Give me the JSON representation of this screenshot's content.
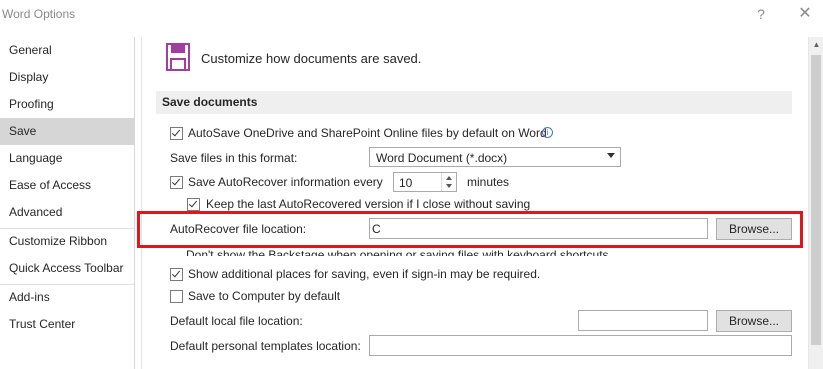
{
  "window": {
    "title": "Word Options",
    "help_glyph": "?",
    "close_glyph": "✕"
  },
  "nav": {
    "items": [
      "General",
      "Display",
      "Proofing",
      "Save",
      "Language",
      "Ease of Access",
      "Advanced",
      "Customize Ribbon",
      "Quick Access Toolbar",
      "Add-ins",
      "Trust Center"
    ],
    "selected": "Save"
  },
  "header": {
    "text": "Customize how documents are saved.",
    "icon": "save-floppy-icon",
    "icon_color": "#a13ea1"
  },
  "section": {
    "title": "Save documents"
  },
  "options": {
    "autosave_label": "AutoSave OneDrive and SharePoint Online files by default on Word",
    "autosave_checked": true,
    "save_format_label": "Save files in this format:",
    "save_format_value": "Word Document (*.docx)",
    "autorecover_label": "Save AutoRecover information every",
    "autorecover_checked": true,
    "autorecover_minutes": "10",
    "minutes_label": "minutes",
    "keep_last_label": "Keep the last AutoRecovered version if I close without saving",
    "keep_last_checked": true,
    "autorecover_location_label": "AutoRecover file location:",
    "autorecover_location_value": "C",
    "browse_label": "Browse...",
    "backstage_label": "Don't show the Backstage when opening or saving files with keyboard shortcuts",
    "additional_places_label": "Show additional places for saving, even if sign-in may be required.",
    "additional_places_checked": true,
    "save_computer_label": "Save to Computer by default",
    "save_computer_checked": false,
    "default_local_label": "Default local file location:",
    "default_local_value": "",
    "browse2_label": "Browse...",
    "default_templates_label": "Default personal templates location:",
    "default_templates_value": ""
  },
  "colors": {
    "highlight": "#e0161d",
    "selected_nav": "#d6d6d6"
  }
}
